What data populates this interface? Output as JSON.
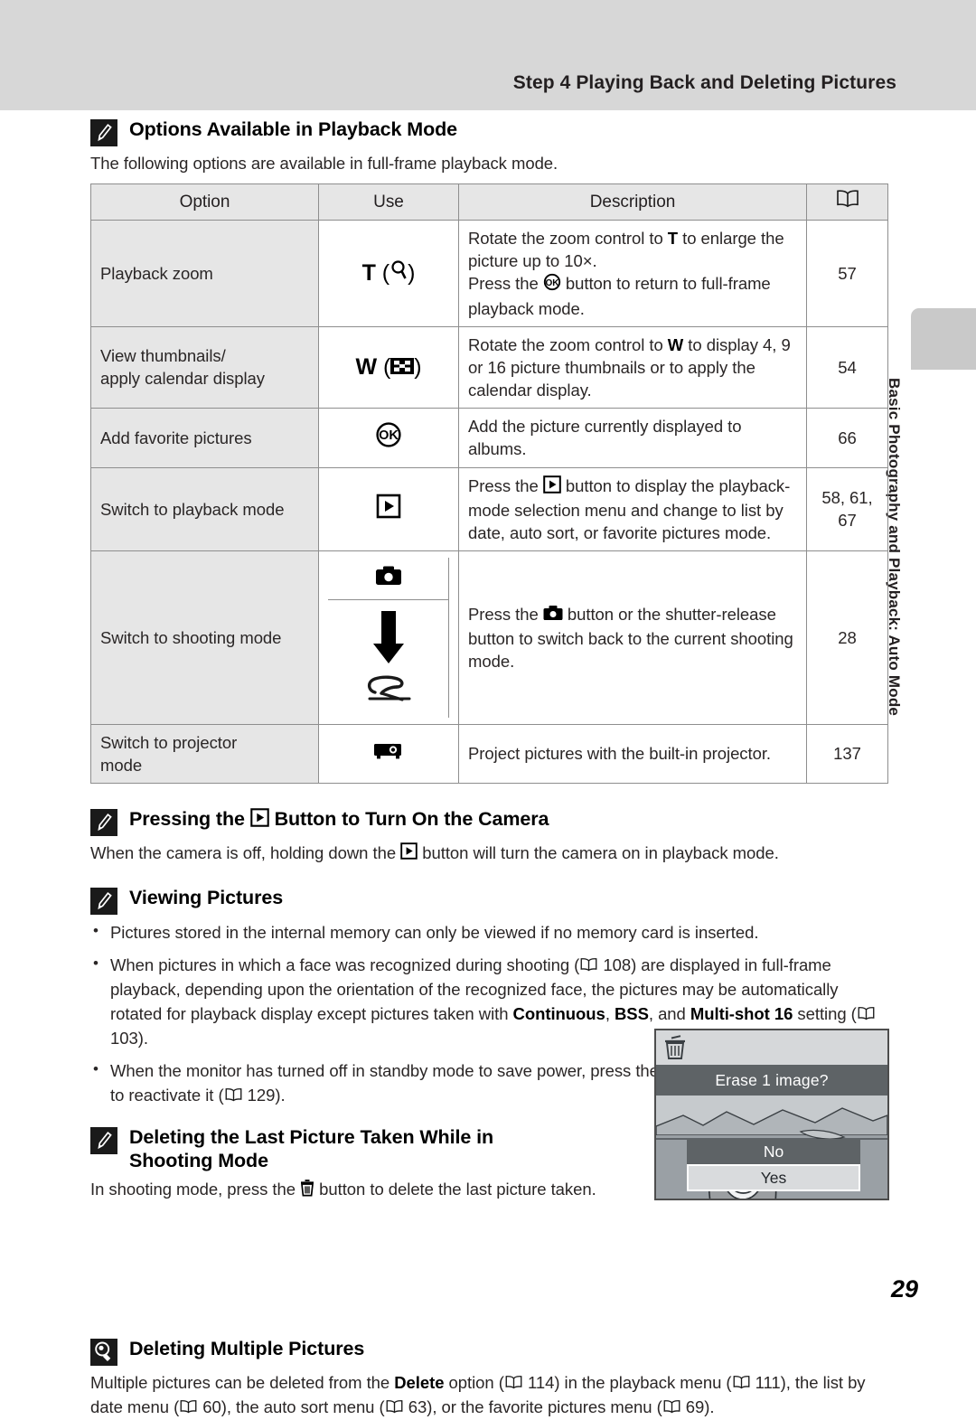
{
  "header": {
    "running_title": "Step 4 Playing Back and Deleting Pictures"
  },
  "side_tab": {
    "label": "Basic Photography and Playback: Auto Mode"
  },
  "page_number": "29",
  "sections": {
    "options_playback": {
      "icon": "note-pencil-icon",
      "title": "Options Available in Playback Mode",
      "intro": "The following options are available in full-frame playback mode."
    },
    "pressing_button": {
      "icon": "note-pencil-icon",
      "title_before": "Pressing the ",
      "title_icon": "playback-button-icon",
      "title_after": " Button to Turn On the Camera",
      "body_before": "When the camera is off, holding down the ",
      "body_icon": "playback-button-icon",
      "body_after": " button will turn the camera on in playback mode."
    },
    "viewing_pictures": {
      "icon": "note-pencil-icon",
      "title": "Viewing Pictures",
      "bullets": [
        {
          "text": "Pictures stored in the internal memory can only be viewed if no memory card is inserted."
        },
        {
          "p1": "When pictures in which a face was recognized during shooting (",
          "ref1": "108",
          "p2": ") are displayed in full-frame playback, depending upon the orientation of the recognized face, the pictures may be automatically rotated for playback display except pictures taken with ",
          "b1": "Continuous",
          "p3": ", ",
          "b2": "BSS",
          "p4": ", and ",
          "b3": "Multi-shot 16",
          "p5": " setting (",
          "ref2": "103",
          "p6": ")."
        },
        {
          "p1": "When the monitor has turned off in standby mode to save power, press the ",
          "icon": "playback-button-icon",
          "p2": " button or the power switch to reactivate it (",
          "ref1": "129",
          "p3": ")."
        }
      ]
    },
    "deleting_last": {
      "icon": "note-pencil-icon",
      "title_line1": "Deleting the Last Picture Taken While in",
      "title_line2": "Shooting Mode",
      "body_before": "In shooting mode, press the ",
      "body_icon": "trash-button-icon",
      "body_after": " button to delete the last picture taken."
    },
    "deleting_multiple": {
      "icon": "tip-lightbulb-icon",
      "title": "Deleting Multiple Pictures",
      "p1": "Multiple pictures can be deleted from the ",
      "b1": "Delete",
      "p2": " option (",
      "ref1": "114",
      "p3": ") in the playback menu (",
      "ref2": "111",
      "p4": "), the list by date menu (",
      "ref3": "60",
      "p5": "), the auto sort menu (",
      "ref4": "63",
      "p6": "), or the favorite pictures menu (",
      "ref5": "69",
      "p7": ")."
    }
  },
  "table": {
    "headers": {
      "option": "Option",
      "use": "Use",
      "description": "Description",
      "page": "book-icon"
    },
    "rows": [
      {
        "option": "Playback zoom",
        "use_letter": "T",
        "use_icon": "magnifier-icon",
        "desc_l1_a": "Rotate the zoom control to ",
        "desc_l1_b": "T",
        "desc_l1_c": " to enlarge the picture up to 10×.",
        "desc_l2_a": "Press the ",
        "desc_l2_icon": "ok-button-icon",
        "desc_l2_b": " button to return to full-frame playback mode.",
        "page": "57"
      },
      {
        "option_l1": "View thumbnails/",
        "option_l2": "apply calendar display",
        "use_letter": "W",
        "use_icon": "thumbnail-grid-icon",
        "desc_a": "Rotate the zoom control to ",
        "desc_b": "W",
        "desc_c": " to display 4, 9 or 16 picture thumbnails or to apply the calendar display.",
        "page": "54"
      },
      {
        "option": "Add favorite pictures",
        "use_icon": "ok-button-icon",
        "desc": "Add the picture currently displayed to albums.",
        "page": "66"
      },
      {
        "option": "Switch to playback mode",
        "use_icon": "playback-button-icon",
        "desc_a": "Press the ",
        "desc_icon": "playback-button-icon",
        "desc_b": " button to display the playback-mode selection menu and change to list by date, auto sort, or favorite pictures mode.",
        "page_l1": "58, 61,",
        "page_l2": "67"
      },
      {
        "option": "Switch to shooting mode",
        "use_icon_top": "camera-icon",
        "use_icon_bottom": "arrow-down-shutter-icon",
        "desc_a": "Press the ",
        "desc_icon": "camera-icon",
        "desc_b": " button or the shutter-release button to switch back to the current shooting mode.",
        "page": "28"
      },
      {
        "option_l1": "Switch to projector",
        "option_l2": "mode",
        "use_icon": "projector-icon",
        "desc": "Project pictures with the built-in projector.",
        "page": "137"
      }
    ]
  },
  "lcd": {
    "trash_icon": "trash-can-icon",
    "title": "Erase 1 image?",
    "options": [
      {
        "label": "No",
        "selected": false
      },
      {
        "label": "Yes",
        "selected": true
      }
    ]
  }
}
